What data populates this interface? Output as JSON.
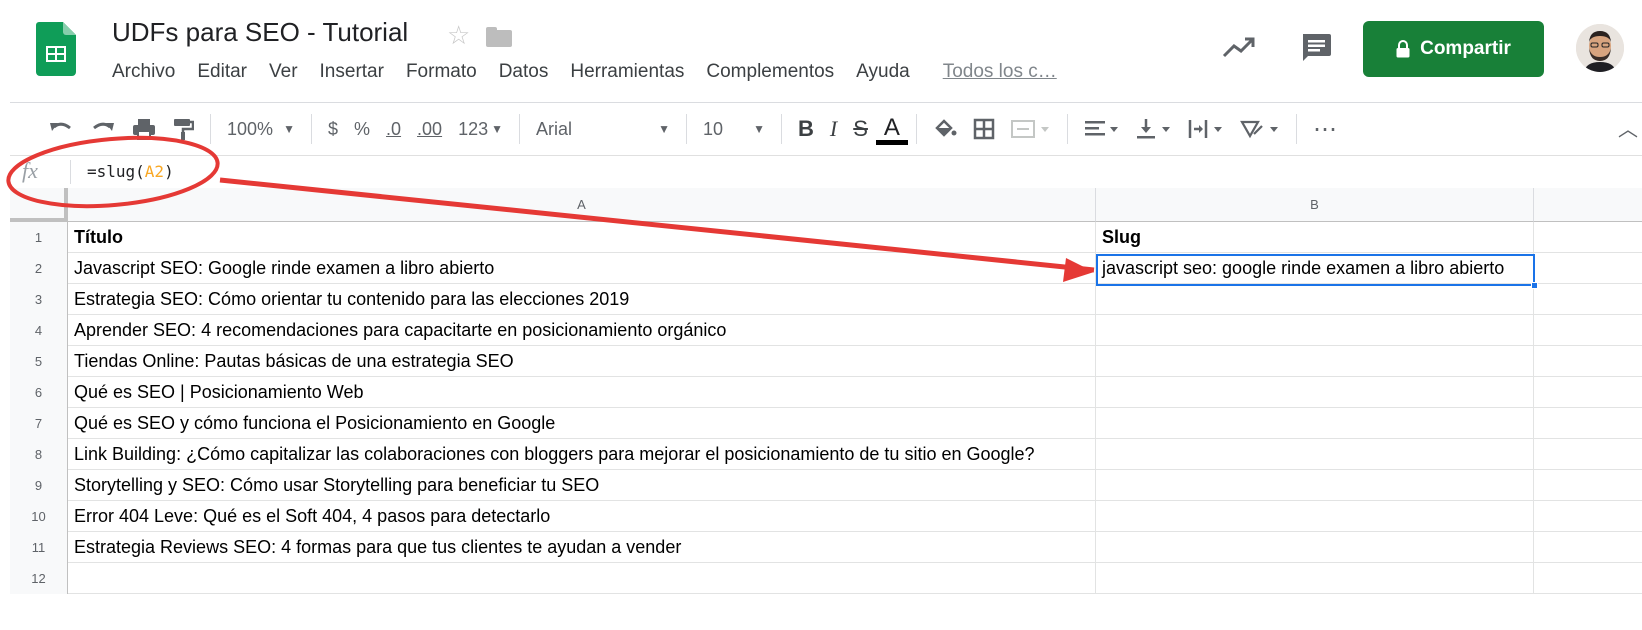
{
  "app": {
    "doc_title": "UDFs para SEO - Tutorial",
    "menu": [
      "Archivo",
      "Editar",
      "Ver",
      "Insertar",
      "Formato",
      "Datos",
      "Herramientas",
      "Complementos",
      "Ayuda"
    ],
    "last_edit_link": "Todos los c…",
    "share_label": "Compartir",
    "brand_color": "#188038",
    "accent_color": "#1a73e8"
  },
  "toolbar": {
    "zoom": "100%",
    "currency": "$",
    "percent": "%",
    "decrease_decimals": ".0",
    "increase_decimals": ".00",
    "more_formats": "123",
    "font": "Arial",
    "font_size": "10",
    "bold": "B",
    "italic": "I",
    "strikethrough": "S",
    "text_color": "A",
    "more": "⋯",
    "icons": [
      "undo-icon",
      "redo-icon",
      "print-icon",
      "paint-format-icon",
      "fill-color-icon",
      "borders-icon",
      "merge-cells-icon",
      "align-left-icon",
      "valign-bottom-icon",
      "text-wrap-icon",
      "text-rotation-icon",
      "collapse-icon"
    ]
  },
  "formula_bar": {
    "fx": "fx",
    "formula_prefix": "=slug(",
    "formula_ref": "A2",
    "formula_suffix": ")"
  },
  "sheet": {
    "columns": [
      "A",
      "B",
      ""
    ],
    "rows": [
      {
        "num": "1",
        "a": "Título",
        "b": "Slug"
      },
      {
        "num": "2",
        "a": "Javascript SEO: Google rinde examen a libro abierto",
        "b": "javascript seo: google rinde examen a libro abierto"
      },
      {
        "num": "3",
        "a": "Estrategia SEO: Cómo orientar tu contenido para las elecciones 2019",
        "b": ""
      },
      {
        "num": "4",
        "a": "Aprender SEO: 4 recomendaciones para capacitarte en posicionamiento orgánico",
        "b": ""
      },
      {
        "num": "5",
        "a": "Tiendas Online: Pautas básicas de una estrategia SEO",
        "b": ""
      },
      {
        "num": "6",
        "a": "Qué es SEO | Posicionamiento Web",
        "b": ""
      },
      {
        "num": "7",
        "a": "Qué es SEO y cómo funciona el Posicionamiento en Google",
        "b": ""
      },
      {
        "num": "8",
        "a": "Link Building: ¿Cómo capitalizar las colaboraciones con bloggers para mejorar el posicionamiento de tu sitio en Google?",
        "b": ""
      },
      {
        "num": "9",
        "a": "Storytelling y SEO: Cómo usar Storytelling para beneficiar tu SEO",
        "b": ""
      },
      {
        "num": "10",
        "a": "Error 404 Leve: Qué es el Soft 404, 4 pasos para detectarlo",
        "b": ""
      },
      {
        "num": "11",
        "a": "Estrategia Reviews SEO: 4 formas para que tus clientes te ayudan a vender",
        "b": ""
      },
      {
        "num": "12",
        "a": "",
        "b": ""
      }
    ],
    "selected_cell": "B2"
  },
  "annotation": {
    "color": "#e53935"
  }
}
